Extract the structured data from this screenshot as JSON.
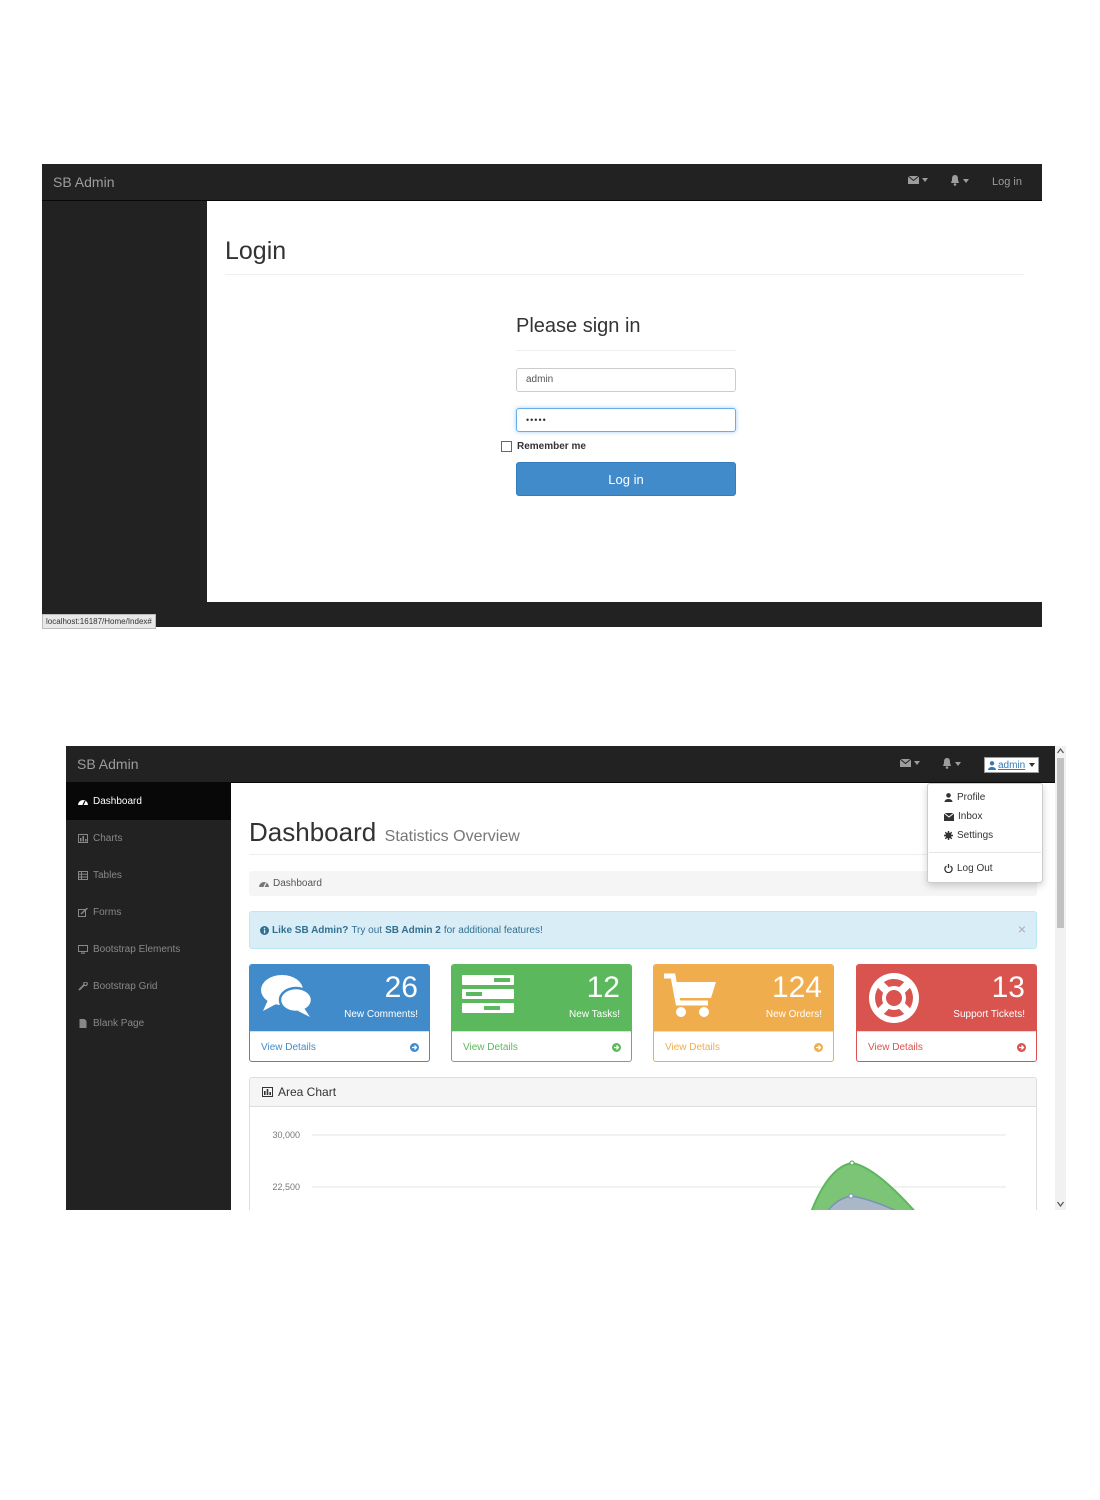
{
  "login_screen": {
    "brand": "SB Admin",
    "nav": {
      "mail_icon": "envelope-icon",
      "bell_icon": "bell-icon",
      "login_link": "Log in"
    },
    "page_title": "Login",
    "form": {
      "title": "Please sign in",
      "username_value": "admin",
      "password_value": "•••••",
      "remember_label": "Remember me",
      "remember_checked": false,
      "submit_label": "Log in"
    },
    "status_url": "localhost:16187/Home/Index#"
  },
  "dashboard_screen": {
    "brand": "SB Admin",
    "nav": {
      "user_label": "admin"
    },
    "user_menu": [
      {
        "label": "Profile",
        "icon": "user-icon"
      },
      {
        "label": "Inbox",
        "icon": "envelope-icon"
      },
      {
        "label": "Settings",
        "icon": "gear-icon"
      },
      {
        "label": "Log Out",
        "icon": "power-icon"
      }
    ],
    "sidebar": [
      {
        "label": "Dashboard",
        "icon": "dashboard-icon",
        "active": true
      },
      {
        "label": "Charts",
        "icon": "bar-chart-icon"
      },
      {
        "label": "Tables",
        "icon": "table-icon"
      },
      {
        "label": "Forms",
        "icon": "edit-icon"
      },
      {
        "label": "Bootstrap Elements",
        "icon": "desktop-icon"
      },
      {
        "label": "Bootstrap Grid",
        "icon": "wrench-icon"
      },
      {
        "label": "Blank Page",
        "icon": "file-icon"
      }
    ],
    "page_title": "Dashboard",
    "page_subtitle": "Statistics Overview",
    "breadcrumb": "Dashboard",
    "alert": {
      "lead": "Like SB Admin?",
      "text_before": "Try out",
      "link": "SB Admin 2",
      "text_after": "for additional features!",
      "close": "×"
    },
    "stat_panels": [
      {
        "count": "26",
        "label": "New Comments!",
        "link": "View Details",
        "color": "#428bca",
        "icon": "comments-icon"
      },
      {
        "count": "12",
        "label": "New Tasks!",
        "link": "View Details",
        "color": "#5cb85c",
        "icon": "tasks-icon"
      },
      {
        "count": "124",
        "label": "New Orders!",
        "link": "View Details",
        "color": "#f0ad4e",
        "icon": "shopping-cart-icon"
      },
      {
        "count": "13",
        "label": "Support Tickets!",
        "link": "View Details",
        "color": "#d9534f",
        "icon": "life-ring-icon"
      }
    ],
    "chart_panel_title": "Area Chart",
    "chart_data": {
      "type": "area",
      "title": "Area Chart",
      "y_ticks": [
        "30,000",
        "22,500"
      ],
      "series": [
        {
          "color": "#5cb85c"
        },
        {
          "color": "#a4b9cf"
        }
      ]
    }
  }
}
